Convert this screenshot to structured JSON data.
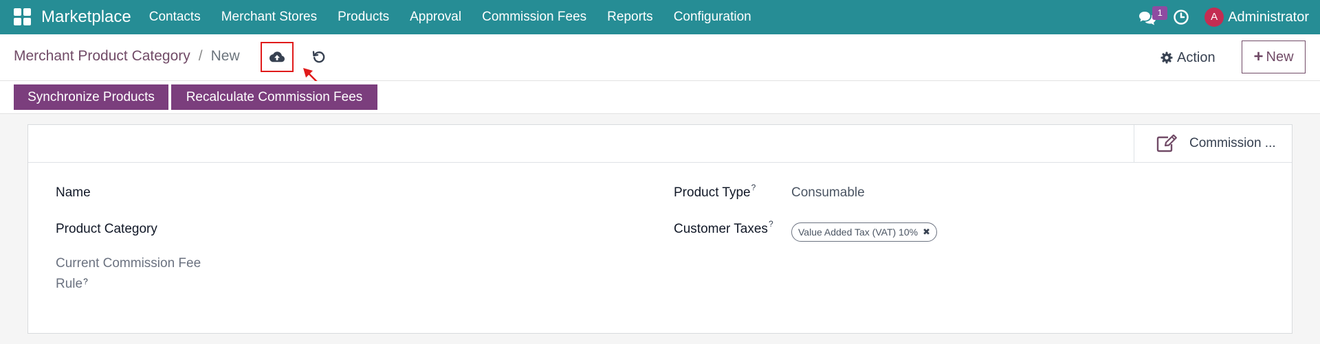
{
  "navbar": {
    "brand": "Marketplace",
    "menu": [
      "Contacts",
      "Merchant Stores",
      "Products",
      "Approval",
      "Commission Fees",
      "Reports",
      "Configuration"
    ],
    "chat_count": "1",
    "user_initial": "A",
    "user_name": "Administrator"
  },
  "breadcrumb": {
    "parent": "Merchant Product Category",
    "separator": "/",
    "current": "New"
  },
  "control": {
    "action_label": "Action",
    "new_label": "New",
    "new_icon": "+"
  },
  "status_buttons": {
    "synchronize": "Synchronize Products",
    "recalculate": "Recalculate Commission Fees"
  },
  "smart_button": {
    "label": "Commission ...",
    "icon": "edit-icon"
  },
  "form": {
    "name_label": "Name",
    "product_category_label": "Product Category",
    "current_commission_label": "Current Commission Fee Rule",
    "product_type_label": "Product Type",
    "product_type_value": "Consumable",
    "customer_taxes_label": "Customer Taxes",
    "tax_tag": "Value Added Tax (VAT) 10%",
    "help_mark": "?"
  },
  "colors": {
    "navbar": "#268d95",
    "brand_purple": "#714b67",
    "primary_button": "#7b3e7d",
    "highlight_box": "#e01a1a"
  }
}
